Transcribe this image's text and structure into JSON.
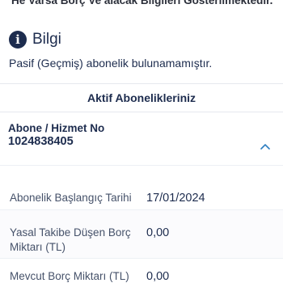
{
  "top_notice": "He Varsa Borç Ve alacak Bilgileri Gösterilmektedir.",
  "info": {
    "icon": "info-icon",
    "icon_glyph": "i",
    "title": "Bilgi",
    "message": "Pasif (Geçmiş) abonelik bulunamamıştır."
  },
  "section": {
    "title": "Aktif Abonelikleriniz"
  },
  "subscription": {
    "label": "Abone / Hizmet No",
    "number": "1024838405",
    "collapse_icon": "chevron-up-icon"
  },
  "details": [
    {
      "label": "Abonelik Başlangıç Tarihi",
      "value": "17/01/2024"
    },
    {
      "label": "Yasal Takibe Düşen Borç Miktarı (TL)",
      "value": "0,00"
    },
    {
      "label": "Mevcut Borç Miktarı (TL)",
      "value": "0,00"
    }
  ],
  "colors": {
    "primary_text": "#1d2c4e",
    "secondary_text": "#46526a",
    "accent": "#2f7fc1"
  }
}
